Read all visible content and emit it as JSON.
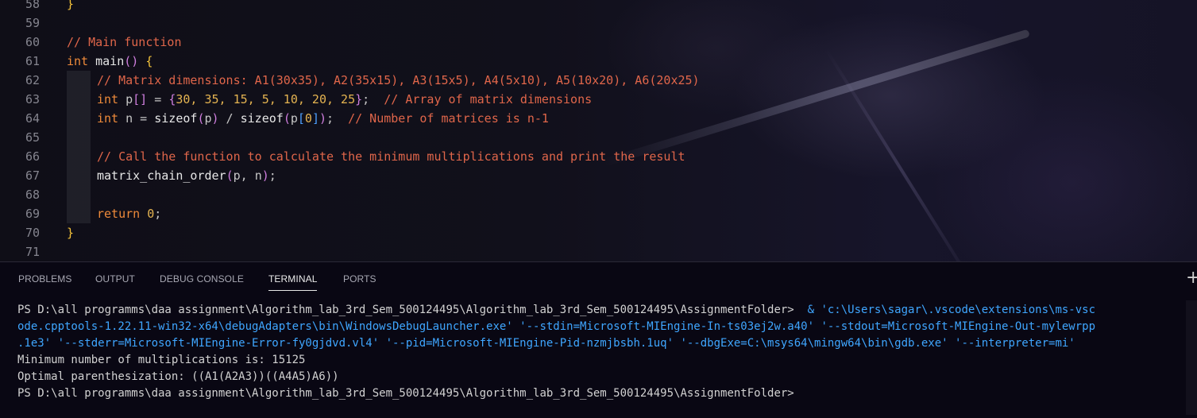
{
  "editor": {
    "lines": [
      {
        "num": "58",
        "parts": [
          {
            "t": "}",
            "c": "pb"
          }
        ]
      },
      {
        "num": "59",
        "parts": []
      },
      {
        "num": "60",
        "parts": [
          {
            "t": "// Main function",
            "c": "cm"
          }
        ]
      },
      {
        "num": "61",
        "parts": [
          {
            "t": "int",
            "c": "kw"
          },
          {
            "t": " main",
            "c": "fn"
          },
          {
            "t": "()",
            "c": "pp"
          },
          {
            "t": " {",
            "c": "pb"
          }
        ]
      },
      {
        "num": "62",
        "indent": 1,
        "parts": [
          {
            "t": "// Matrix dimensions: A1(30x35), A2(35x15), A3(15x5), A4(5x10), A5(10x20), A6(20x25)",
            "c": "cm"
          }
        ]
      },
      {
        "num": "63",
        "indent": 1,
        "parts": [
          {
            "t": "int",
            "c": "kw"
          },
          {
            "t": " p",
            "c": "id"
          },
          {
            "t": "[]",
            "c": "pp"
          },
          {
            "t": " = ",
            "c": "id"
          },
          {
            "t": "{",
            "c": "pp"
          },
          {
            "t": "30, 35, 15, 5, 10, 20, 25",
            "c": "num"
          },
          {
            "t": "}",
            "c": "pp"
          },
          {
            "t": ";  ",
            "c": "id"
          },
          {
            "t": "// Array of matrix dimensions",
            "c": "cm"
          }
        ]
      },
      {
        "num": "64",
        "indent": 1,
        "parts": [
          {
            "t": "int",
            "c": "kw"
          },
          {
            "t": " n = ",
            "c": "id"
          },
          {
            "t": "sizeof",
            "c": "fn"
          },
          {
            "t": "(",
            "c": "pp"
          },
          {
            "t": "p",
            "c": "id"
          },
          {
            "t": ")",
            "c": "pp"
          },
          {
            "t": " / ",
            "c": "id"
          },
          {
            "t": "sizeof",
            "c": "fn"
          },
          {
            "t": "(",
            "c": "pp"
          },
          {
            "t": "p",
            "c": "id"
          },
          {
            "t": "[",
            "c": "pc"
          },
          {
            "t": "0",
            "c": "num"
          },
          {
            "t": "]",
            "c": "pc"
          },
          {
            "t": ")",
            "c": "pp"
          },
          {
            "t": ";  ",
            "c": "id"
          },
          {
            "t": "// Number of matrices is n-1",
            "c": "cm"
          }
        ]
      },
      {
        "num": "65",
        "indent": 1,
        "parts": []
      },
      {
        "num": "66",
        "indent": 1,
        "parts": [
          {
            "t": "// Call the function to calculate the minimum multiplications and print the result",
            "c": "cm"
          }
        ]
      },
      {
        "num": "67",
        "indent": 1,
        "parts": [
          {
            "t": "matrix_chain_order",
            "c": "fn"
          },
          {
            "t": "(",
            "c": "pp"
          },
          {
            "t": "p",
            "c": "id"
          },
          {
            "t": ", ",
            "c": "id"
          },
          {
            "t": "n",
            "c": "id"
          },
          {
            "t": ")",
            "c": "pp"
          },
          {
            "t": ";",
            "c": "id"
          }
        ]
      },
      {
        "num": "68",
        "indent": 1,
        "parts": []
      },
      {
        "num": "69",
        "indent": 1,
        "parts": [
          {
            "t": "return",
            "c": "kw"
          },
          {
            "t": " ",
            "c": "id"
          },
          {
            "t": "0",
            "c": "num"
          },
          {
            "t": ";",
            "c": "id"
          }
        ]
      },
      {
        "num": "70",
        "parts": [
          {
            "t": "}",
            "c": "pb"
          }
        ]
      },
      {
        "num": "71",
        "parts": []
      }
    ]
  },
  "panel": {
    "tabs": [
      {
        "label": "PROBLEMS",
        "name": "tab-problems"
      },
      {
        "label": "OUTPUT",
        "name": "tab-output"
      },
      {
        "label": "DEBUG CONSOLE",
        "name": "tab-debug-console"
      },
      {
        "label": "TERMINAL",
        "name": "tab-terminal",
        "active": true
      },
      {
        "label": "PORTS",
        "name": "tab-ports"
      }
    ],
    "plus_icon": "plus-icon",
    "terminal": {
      "prompt": "PS D:\\all programms\\daa assignment\\Algorithm_lab_3rd_Sem_500124495\\Algorithm_lab_3rd_Sem_500124495\\AssignmentFolder>",
      "command_line_1": "  & 'c:\\Users\\sagar\\.vscode\\extensions\\ms-vsc",
      "command_line_2": "ode.cpptools-1.22.11-win32-x64\\debugAdapters\\bin\\WindowsDebugLauncher.exe' '--stdin=Microsoft-MIEngine-In-ts03ej2w.a40' '--stdout=Microsoft-MIEngine-Out-mylewrpp",
      "command_line_3": ".1e3' '--stderr=Microsoft-MIEngine-Error-fy0gjdvd.vl4' '--pid=Microsoft-MIEngine-Pid-nzmjbsbh.1uq' '--dbgExe=C:\\msys64\\mingw64\\bin\\gdb.exe' '--interpreter=mi'",
      "output_1": "Minimum number of multiplications is: 15125",
      "output_2": "Optimal parenthesization: ((A1(A2A3))((A4A5)A6))",
      "prompt_2": "PS D:\\all programms\\daa assignment\\Algorithm_lab_3rd_Sem_500124495\\Algorithm_lab_3rd_Sem_500124495\\AssignmentFolder>"
    }
  }
}
